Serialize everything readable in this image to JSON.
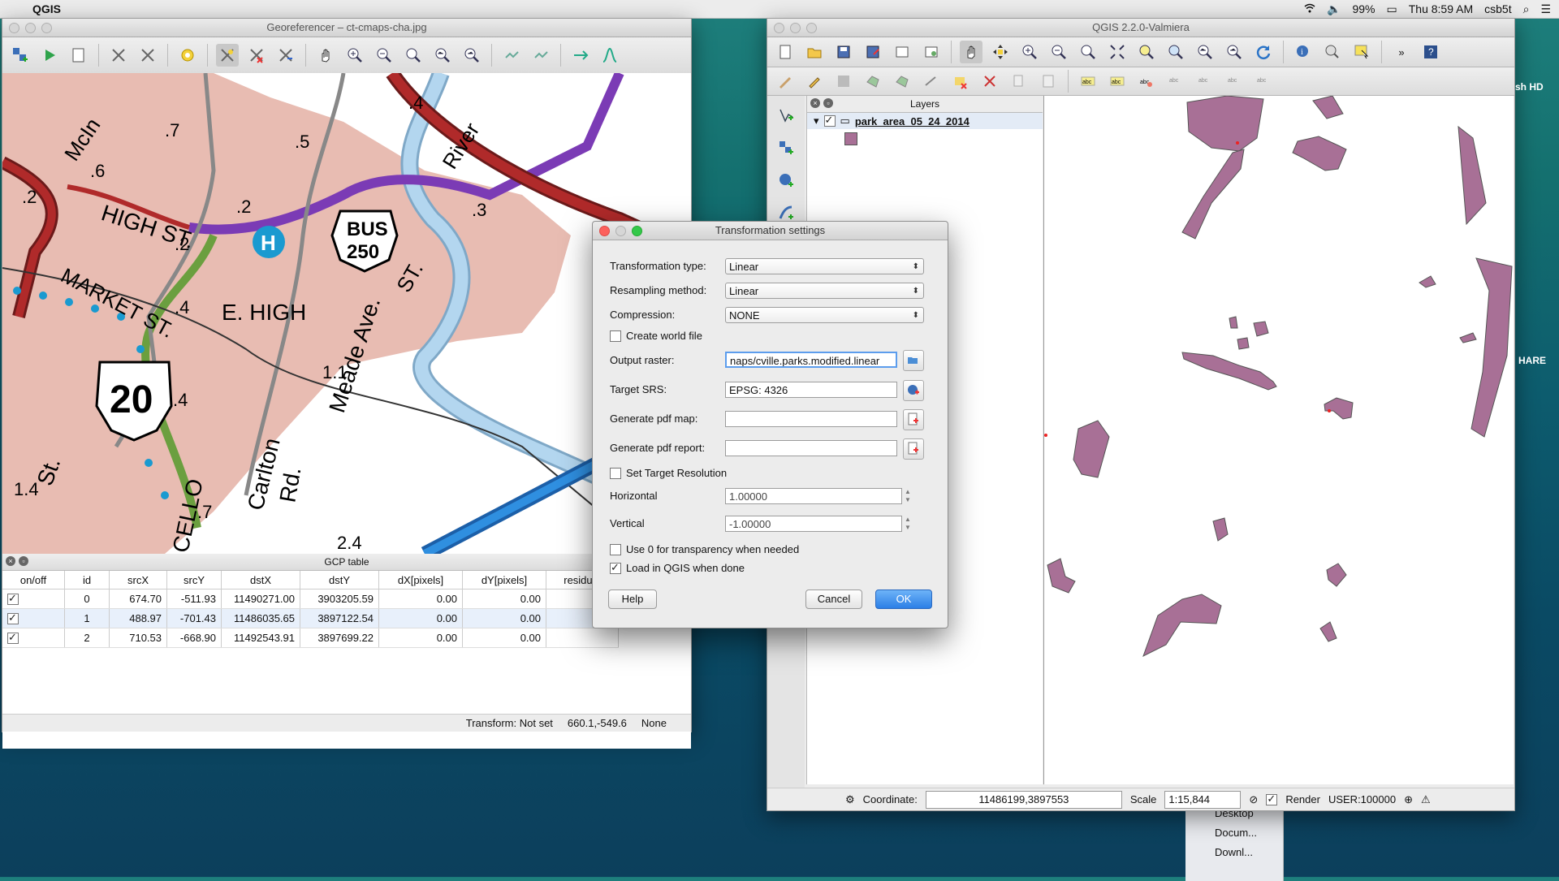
{
  "menubar": {
    "app_name": "QGIS",
    "battery": "99%",
    "clock": "Thu 8:59 AM",
    "user": "csb5t"
  },
  "georef_window": {
    "title": "Georeferencer – ct-cmaps-cha.jpg",
    "map_labels": {
      "high_st": "HIGH ST.",
      "market_st": "MARKET ST.",
      "e_high": "E. HIGH",
      "st_ave": "ST.",
      "meade": "Meade Ave.",
      "carlton": "Carlton",
      "rd": "Rd.",
      "river": "River",
      "mcin": "McIn",
      "st_left": "St.",
      "cello": "CELLO",
      "bus": "BUS",
      "bus_num": "250",
      "route": "20",
      "hospital": "H",
      "m_p5": ".5",
      "m_p7": ".7",
      "m_p6": ".6",
      "m_p2a": ".2",
      "m_p2b": ".2",
      "m_p2c": ".2",
      "m_p4a": ".4",
      "m_p4b": ".4",
      "m_p4c": ".4",
      "m_p3": ".3",
      "m_11": "1.1",
      "m_14": "1.4",
      "m_p7b": ".7",
      "m_24": "2.4"
    },
    "gcp_table": {
      "title": "GCP table",
      "columns": [
        "on/off",
        "id",
        "srcX",
        "srcY",
        "dstX",
        "dstY",
        "dX[pixels]",
        "dY[pixels]",
        "residual"
      ],
      "rows": [
        {
          "id": "0",
          "srcX": "674.70",
          "srcY": "-511.93",
          "dstX": "11490271.00",
          "dstY": "3903205.59",
          "dX": "0.00",
          "dY": "0.00"
        },
        {
          "id": "1",
          "srcX": "488.97",
          "srcY": "-701.43",
          "dstX": "11486035.65",
          "dstY": "3897122.54",
          "dX": "0.00",
          "dY": "0.00"
        },
        {
          "id": "2",
          "srcX": "710.53",
          "srcY": "-668.90",
          "dstX": "11492543.91",
          "dstY": "3897699.22",
          "dX": "0.00",
          "dY": "0.00"
        }
      ]
    },
    "status": {
      "transform": "Transform: Not set",
      "coords": "660.1,-549.6",
      "crs": "None"
    }
  },
  "qgis_window": {
    "title": "QGIS 2.2.0-Valmiera",
    "layers_title": "Layers",
    "layer_name": "park_area_05_24_2014",
    "status": {
      "coordinate_label": "Coordinate:",
      "coordinate_value": "11486199,3897553",
      "scale_label": "Scale",
      "scale_value": "1:15,844",
      "render_label": "Render",
      "crs": "USER:100000"
    },
    "right_edge": {
      "hd": "sh HD",
      "share": "HARE"
    }
  },
  "dialog": {
    "title": "Transformation settings",
    "transformation_type_label": "Transformation type:",
    "transformation_type": "Linear",
    "resampling_label": "Resampling method:",
    "resampling": "Linear",
    "compression_label": "Compression:",
    "compression": "NONE",
    "create_world_file": "Create world file",
    "output_raster_label": "Output raster:",
    "output_raster": "naps/cville.parks.modified.linear",
    "target_srs_label": "Target SRS:",
    "target_srs": "EPSG: 4326",
    "pdf_map_label": "Generate pdf map:",
    "pdf_report_label": "Generate pdf report:",
    "set_target_resolution": "Set Target Resolution",
    "horizontal_label": "Horizontal",
    "horizontal": "1.00000",
    "vertical_label": "Vertical",
    "vertical": "-1.00000",
    "use_zero": "Use 0 for transparency when needed",
    "load_in_qgis": "Load in QGIS when done",
    "help": "Help",
    "cancel": "Cancel",
    "ok": "OK"
  },
  "finder": {
    "items": [
      "Desktop",
      "Docum...",
      "Downl..."
    ]
  },
  "colors": {
    "park_fill": "#a87096",
    "map_pink": "#e8bcb2",
    "river_blue": "#b3d6ef",
    "road_red": "#b02a2a",
    "road_purple": "#7b3bb5"
  }
}
